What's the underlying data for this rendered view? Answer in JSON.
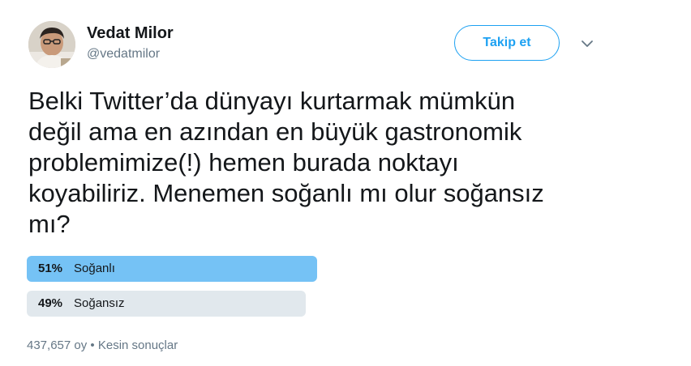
{
  "user": {
    "display_name": "Vedat Milor",
    "handle": "@vedatmilor"
  },
  "follow_button": {
    "label": "Takip et"
  },
  "tweet": {
    "text_lines": [
      "Belki Twitter’da dünyayı kurtarmak mümkün",
      "değil ama en azından en büyük gastronomik",
      "problemimize(!) hemen burada noktayı",
      "koyabiliriz. Menemen soğanlı mı olur soğansız",
      "mı?"
    ]
  },
  "poll": {
    "options": [
      {
        "percent_label": "51%",
        "label": "Soğanlı",
        "percent": 51,
        "color": "#75c2f5",
        "winner": true
      },
      {
        "percent_label": "49%",
        "label": "Soğansız",
        "percent": 49,
        "color": "#e1e8ed",
        "winner": false
      }
    ],
    "votes": "437,657 oy",
    "separator": "•",
    "status": "Kesin sonuçlar"
  },
  "icons": {
    "avatar": "profile-photo",
    "caret": "chevron-down-icon"
  },
  "colors": {
    "accent": "#1da1f2",
    "text": "#14171a",
    "secondary_text": "#657786"
  }
}
